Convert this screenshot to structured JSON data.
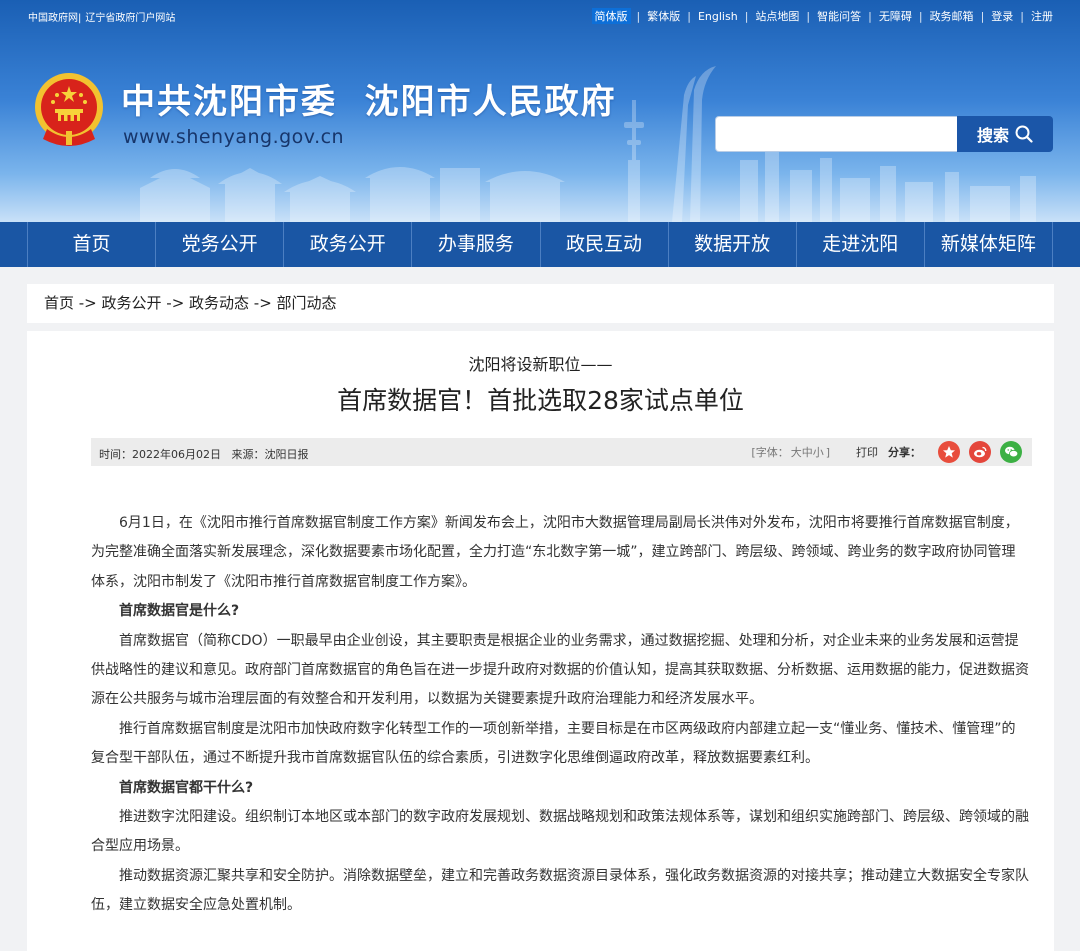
{
  "topbar": {
    "left_links": [
      "中国政府网",
      "|",
      "辽宁省政府门户网站"
    ],
    "right_links": [
      "简体版",
      "繁体版",
      "English",
      "站点地图",
      "智能问答",
      "无障碍",
      "政务邮箱",
      "登录",
      "注册"
    ]
  },
  "site": {
    "title": "中共沈阳市委  沈阳市人民政府",
    "url": "www.shenyang.gov.cn"
  },
  "search": {
    "placeholder": "",
    "button_label": "搜索"
  },
  "nav": [
    "首页",
    "党务公开",
    "政务公开",
    "办事服务",
    "政民互动",
    "数据开放",
    "走进沈阳",
    "新媒体矩阵"
  ],
  "breadcrumb": "首页 -> 政务公开 -> 政务动态 -> 部门动态",
  "article": {
    "subtitle": "沈阳将设新职位——",
    "title": "首席数据官！首批选取28家试点单位",
    "time": "时间：2022年06月02日",
    "source": "来源：沈阳日报",
    "font_label_open": "[字体：",
    "font_sizes": [
      "大",
      "中",
      "小"
    ],
    "font_label_close": "]",
    "print": "打印",
    "share": "分享：",
    "paragraphs": [
      {
        "type": "p",
        "text": "6月1日，在《沈阳市推行首席数据官制度工作方案》新闻发布会上，沈阳市大数据管理局副局长洪伟对外发布，沈阳市将要推行首席数据官制度，为完整准确全面落实新发展理念，深化数据要素市场化配置，全力打造“东北数字第一城”，建立跨部门、跨层级、跨领域、跨业务的数字政府协同管理体系，沈阳市制发了《沈阳市推行首席数据官制度工作方案》。"
      },
      {
        "type": "h",
        "text": "首席数据官是什么?"
      },
      {
        "type": "p",
        "text": "首席数据官（简称CDO）一职最早由企业创设，其主要职责是根据企业的业务需求，通过数据挖掘、处理和分析，对企业未来的业务发展和运营提供战略性的建议和意见。政府部门首席数据官的角色旨在进一步提升政府对数据的价值认知，提高其获取数据、分析数据、运用数据的能力，促进数据资源在公共服务与城市治理层面的有效整合和开发利用，以数据为关键要素提升政府治理能力和经济发展水平。"
      },
      {
        "type": "p",
        "text": "推行首席数据官制度是沈阳市加快政府数字化转型工作的一项创新举措，主要目标是在市区两级政府内部建立起一支“懂业务、懂技术、懂管理”的复合型干部队伍，通过不断提升我市首席数据官队伍的综合素质，引进数字化思维倒逼政府改革，释放数据要素红利。"
      },
      {
        "type": "h",
        "text": "首席数据官都干什么?"
      },
      {
        "type": "p",
        "text": "推进数字沈阳建设。组织制订本地区或本部门的数字政府发展规划、数据战略规划和政策法规体系等，谋划和组织实施跨部门、跨层级、跨领域的融合型应用场景。"
      },
      {
        "type": "p",
        "text": "推动数据资源汇聚共享和安全防护。消除数据壁垒，建立和完善政务数据资源目录体系，强化政务数据资源的对接共享；推动建立大数据安全专家队伍，建立数据安全应急处置机制。"
      }
    ]
  },
  "colors": {
    "nav_bg": "#1a56a4",
    "header_top": "#1a5fb4",
    "search_button": "#1b56a8",
    "page_bg": "#f1f2f4"
  },
  "icons": [
    "national-emblem-icon",
    "search-icon",
    "share-favorite-icon",
    "weibo-icon",
    "wechat-icon"
  ]
}
